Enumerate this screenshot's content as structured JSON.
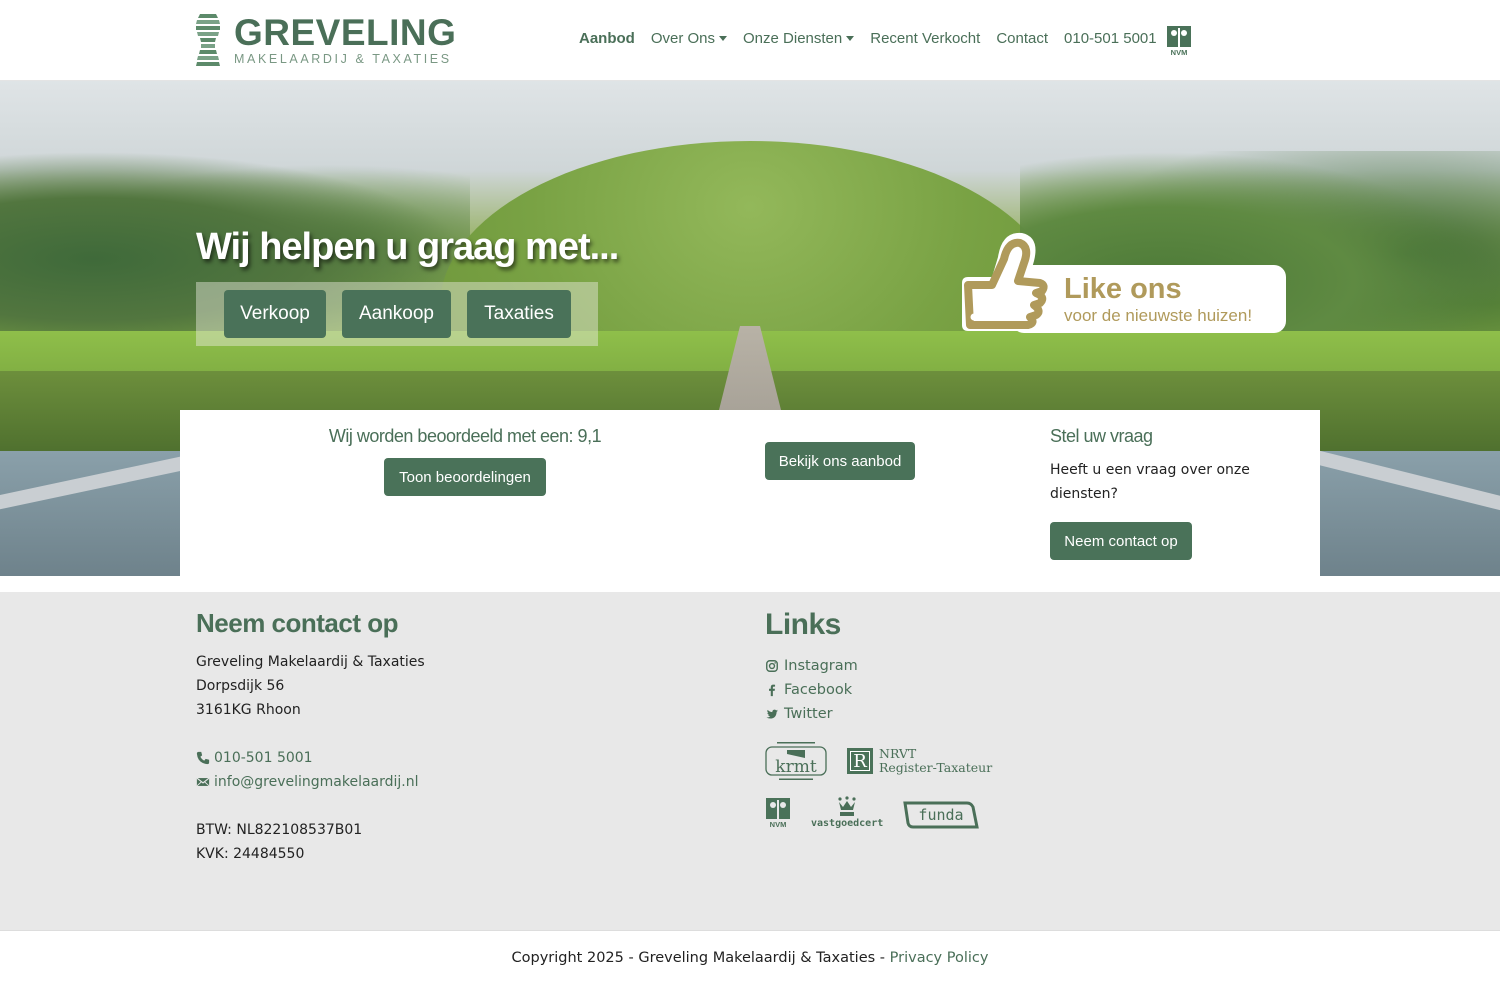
{
  "brand": {
    "name": "GREVELING",
    "tagline": "MAKELAARDIJ & TAXATIES",
    "primary_color": "#4a7259",
    "gold_color": "#b09a5b"
  },
  "nav": {
    "items": [
      {
        "label": "Aanbod",
        "active": true,
        "dropdown": false
      },
      {
        "label": "Over Ons",
        "active": false,
        "dropdown": true
      },
      {
        "label": "Onze Diensten",
        "active": false,
        "dropdown": true
      },
      {
        "label": "Recent Verkocht",
        "active": false,
        "dropdown": false
      },
      {
        "label": "Contact",
        "active": false,
        "dropdown": false
      },
      {
        "label": "010-501 5001",
        "active": false,
        "dropdown": false
      }
    ],
    "badge_label": "NVM"
  },
  "hero": {
    "title": "Wij helpen u graag met...",
    "buttons": [
      "Verkoop",
      "Aankoop",
      "Taxaties"
    ],
    "like": {
      "title": "Like ons",
      "subtitle": "voor de nieuwste huizen!"
    }
  },
  "card": {
    "rating_text": "Wij worden beoordeeld met een: 9,1",
    "rating_button": "Toon beoordelingen",
    "offer_button": "Bekijk ons aanbod",
    "question_title": "Stel uw vraag",
    "question_text": "Heeft u een vraag over onze diensten?",
    "contact_button": "Neem contact op"
  },
  "footer": {
    "contact": {
      "title": "Neem contact op",
      "company": "Greveling Makelaardij & Taxaties",
      "street": "Dorpsdijk 56",
      "city": "3161KG Rhoon",
      "phone": "010-501 5001",
      "email": "info@grevelingmakelaardij.nl",
      "btw": "BTW: NL822108537B01",
      "kvk": "KVK: 24484550"
    },
    "links": {
      "title": "Links",
      "items": [
        {
          "label": "Instagram",
          "icon": "instagram-icon"
        },
        {
          "label": "Facebook",
          "icon": "facebook-icon"
        },
        {
          "label": "Twitter",
          "icon": "twitter-icon"
        }
      ],
      "partner_logos": {
        "krmt": "krmt",
        "nrvt_line1": "NRVT",
        "nrvt_line2": "Register-Taxateur",
        "nrvt_letter": "R",
        "nvm": "NVM",
        "vastgoedcert": "vastgoedcert",
        "funda": "funda"
      }
    }
  },
  "copyright": {
    "text": "Copyright 2025 - Greveling Makelaardij & Taxaties - ",
    "privacy_label": "Privacy Policy"
  }
}
